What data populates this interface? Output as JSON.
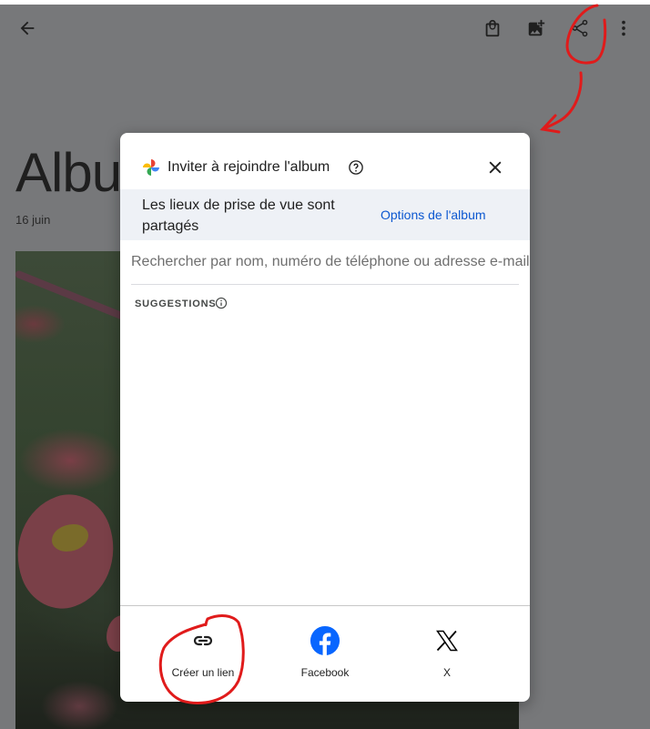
{
  "header": {
    "back_icon": "arrow-back-icon",
    "actions": [
      {
        "name": "order-photos",
        "icon": "shopping-bag-icon"
      },
      {
        "name": "add-photos",
        "icon": "add-photo-icon"
      },
      {
        "name": "share",
        "icon": "share-icon"
      },
      {
        "name": "more-options",
        "icon": "more-vert-icon"
      }
    ]
  },
  "album": {
    "title": "Album",
    "date": "16 juin"
  },
  "dialog": {
    "title": "Inviter à rejoindre l'album",
    "notice": "Les lieux de prise de vue sont partagés",
    "options_link": "Options de l'album",
    "search_placeholder": "Rechercher par nom, numéro de téléphone ou adresse e-mail",
    "search_value": "",
    "suggestions_label": "SUGGESTIONS",
    "share_options": [
      {
        "label": "Créer un lien",
        "icon": "link-icon"
      },
      {
        "label": "Facebook",
        "icon": "facebook-icon",
        "color": "#0866ff"
      },
      {
        "label": "X",
        "icon": "x-logo-icon"
      }
    ]
  },
  "colors": {
    "scrim": "#77787a",
    "link": "#0b57d0",
    "notice_bg": "#eef1f6",
    "annotation": "#e01b1b"
  }
}
